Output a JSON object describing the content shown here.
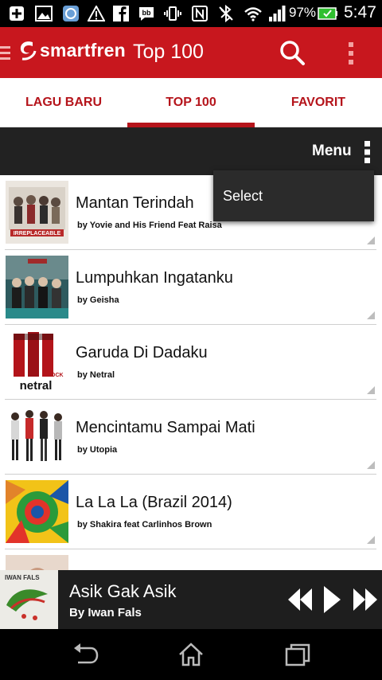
{
  "status_bar": {
    "icons": [
      "add-icon",
      "image-icon",
      "app-icon",
      "warning-icon",
      "facebook-icon",
      "bbm-icon",
      "vibrate-icon",
      "nfc-icon",
      "bluetooth-icon",
      "wifi-icon",
      "signal-icon",
      "battery-icon"
    ],
    "battery_percent": "97%",
    "time": "5:47"
  },
  "app_bar": {
    "brand": "smartfren",
    "title": "Top 100",
    "colors": {
      "primary": "#c8171e"
    }
  },
  "tabs": [
    {
      "label": "LAGU BARU",
      "active": false
    },
    {
      "label": "TOP 100",
      "active": true
    },
    {
      "label": "FAVORIT",
      "active": false
    }
  ],
  "menu_bar": {
    "label": "Menu"
  },
  "dropdown": {
    "items": [
      "Select"
    ]
  },
  "songs": [
    {
      "title": "Mantan Terindah",
      "artist": "by Yovie and His Friend Feat Raisa",
      "cover_text": "IRREPLACEABLE"
    },
    {
      "title": "Lumpuhkan Ingatanku",
      "artist": "by Geisha",
      "cover_text": ""
    },
    {
      "title": "Garuda Di Dadaku",
      "artist": "by Netral",
      "cover_text": "netral"
    },
    {
      "title": "Mencintamu Sampai Mati",
      "artist": "by Utopia",
      "cover_text": ""
    },
    {
      "title": "La La La (Brazil 2014)",
      "artist": "by Shakira feat Carlinhos Brown",
      "cover_text": ""
    }
  ],
  "player": {
    "title": "Asik Gak Asik",
    "artist": "By Iwan Fals",
    "cover_text": "IWAN FALS"
  },
  "nav_bar": {
    "buttons": [
      "back-icon",
      "home-icon",
      "recents-icon"
    ]
  }
}
